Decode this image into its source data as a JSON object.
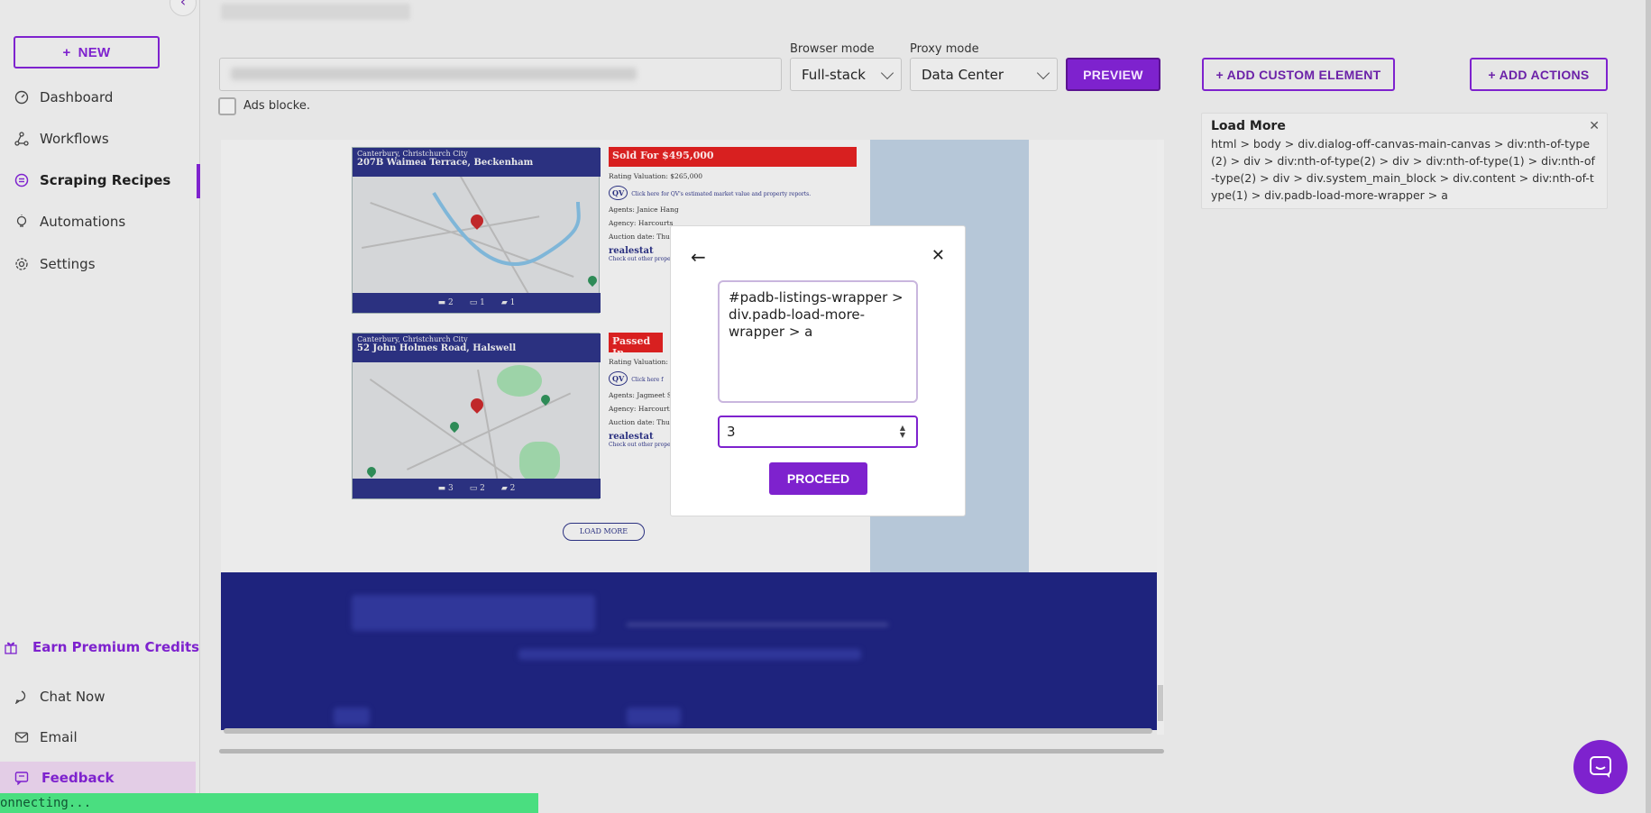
{
  "sidebar": {
    "new_label": "NEW",
    "items": [
      {
        "label": "Dashboard",
        "icon": "gauge-icon"
      },
      {
        "label": "Workflows",
        "icon": "workflow-icon"
      },
      {
        "label": "Scraping Recipes",
        "icon": "recipes-icon"
      },
      {
        "label": "Automations",
        "icon": "bulb-icon"
      },
      {
        "label": "Settings",
        "icon": "gear-icon"
      }
    ],
    "earn_label": "Earn Premium Credits",
    "chat_label": "Chat Now",
    "email_label": "Email",
    "feedback_label": "Feedback",
    "status_text": "onnecting..."
  },
  "toolbar": {
    "ads_label": "Ads blocke.",
    "browser_mode_label": "Browser mode",
    "browser_mode_value": "Full-stack",
    "proxy_mode_label": "Proxy mode",
    "proxy_mode_value": "Data Center",
    "preview_label": "PREVIEW",
    "add_custom_label": "+ ADD CUSTOM ELEMENT",
    "add_actions_label": "+ ADD ACTIONS"
  },
  "element_card": {
    "title": "Load More",
    "path": "html > body > div.dialog-off-canvas-main-canvas > div:nth-of-type(2) > div > div:nth-of-type(2) > div > div:nth-of-type(1) > div:nth-of-type(2) > div > div.system_main_block > div.content > div:nth-of-type(1) > div.padb-load-more-wrapper > a"
  },
  "listings": [
    {
      "suburb": "Canterbury, Christchurch City",
      "address": "207B Waimea Terrace, Beckenham",
      "status": "Sold For $495,000",
      "rating": "Rating Valuation: $265,000",
      "qv_text": "Click here for QV's estimated market value and property reports.",
      "agents": "Agents: Janice Hang",
      "agency": "Agency: Harcourts",
      "auction": "Auction date: Thu",
      "re_label": "realestat",
      "other_link": "Check out other prope",
      "beds": "2",
      "baths": "1",
      "cars": "1"
    },
    {
      "suburb": "Canterbury, Christchurch City",
      "address": "52 John Holmes Road, Halswell",
      "status": "Passed In",
      "rating": "Rating Valuation:",
      "qv_text": "Click here f",
      "agents": "Agents: Jagmeet Si",
      "agency": "Agency: Harcourts",
      "auction": "Auction date: Thu",
      "re_label": "realestat",
      "other_link": "Check out other prope",
      "beds": "3",
      "baths": "2",
      "cars": "2"
    }
  ],
  "load_more_pill": "LOAD MORE",
  "modal": {
    "selector_value": "#padb-listings-wrapper > div.padb-load-more-wrapper > a",
    "number_value": "3",
    "proceed_label": "PROCEED"
  },
  "colors": {
    "accent": "#7e22ce",
    "listing_header": "#2b3180",
    "sold_red": "#d82020",
    "status_green": "#4ade80"
  }
}
